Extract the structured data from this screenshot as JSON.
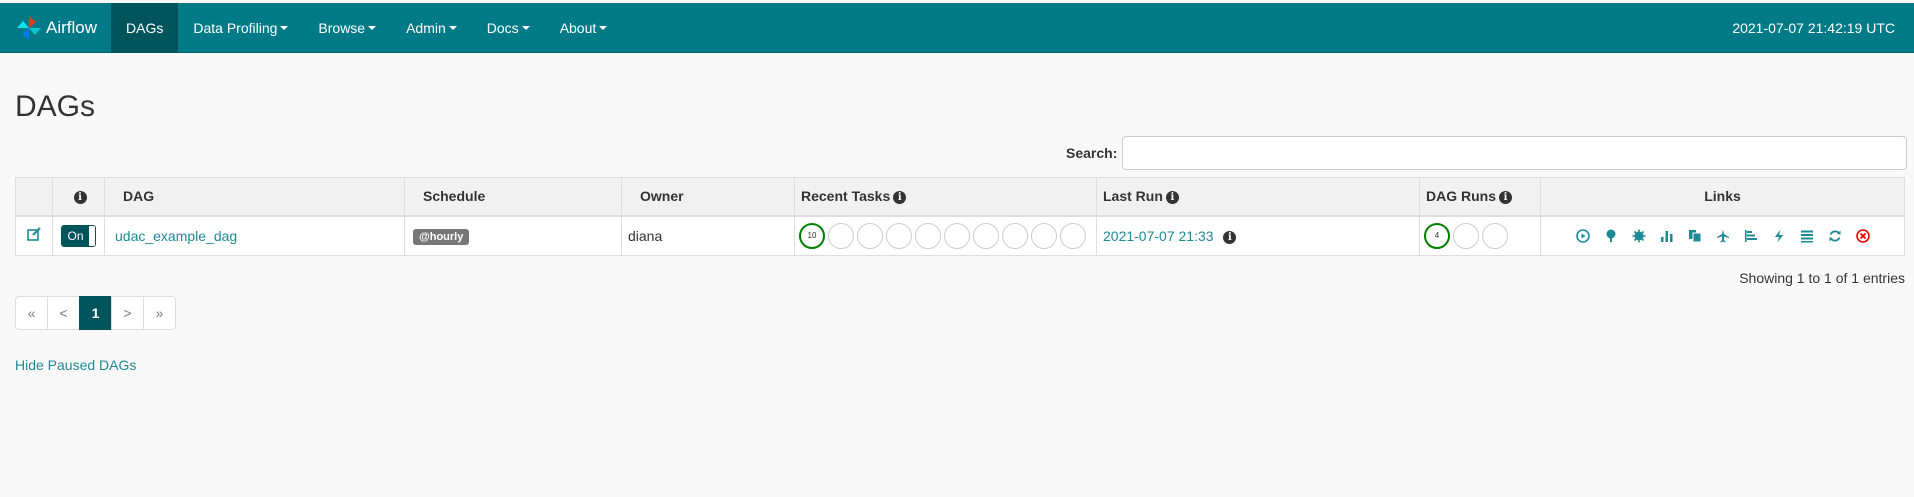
{
  "colors": {
    "navbar": "#007a87",
    "navbar_active": "#00545c",
    "link": "#1e8a96",
    "success": "#008000"
  },
  "navbar": {
    "brand": "Airflow",
    "items": [
      {
        "label": "DAGs",
        "active": true,
        "dropdown": false
      },
      {
        "label": "Data Profiling",
        "dropdown": true
      },
      {
        "label": "Browse",
        "dropdown": true
      },
      {
        "label": "Admin",
        "dropdown": true
      },
      {
        "label": "Docs",
        "dropdown": true
      },
      {
        "label": "About",
        "dropdown": true
      }
    ],
    "clock": "2021-07-07 21:42:19 UTC"
  },
  "page": {
    "title": "DAGs"
  },
  "search": {
    "label": "Search:",
    "value": ""
  },
  "table": {
    "headers": {
      "dag": "DAG",
      "schedule": "Schedule",
      "owner": "Owner",
      "recent_tasks": "Recent Tasks",
      "last_run": "Last Run",
      "dag_runs": "DAG Runs",
      "links": "Links"
    },
    "rows": [
      {
        "toggle": "On",
        "dag_id": "udac_example_dag",
        "schedule": "@hourly",
        "owner": "diana",
        "recent_tasks": [
          "10",
          "",
          "",
          "",
          "",
          "",
          "",
          "",
          "",
          ""
        ],
        "last_run": "2021-07-07 21:33",
        "dag_runs": [
          "4",
          "",
          ""
        ]
      }
    ],
    "link_icons": [
      "trigger-dag-icon",
      "tree-view-icon",
      "graph-view-icon",
      "task-duration-icon",
      "task-tries-icon",
      "landing-times-icon",
      "gantt-icon",
      "code-view-icon",
      "logs-icon",
      "refresh-icon",
      "delete-dag-icon"
    ]
  },
  "footer": {
    "entries": "Showing 1 to 1 of 1 entries",
    "pager": {
      "first": "«",
      "prev": "<",
      "current": "1",
      "next": ">",
      "last": "»"
    },
    "hide_paused": "Hide Paused DAGs"
  }
}
